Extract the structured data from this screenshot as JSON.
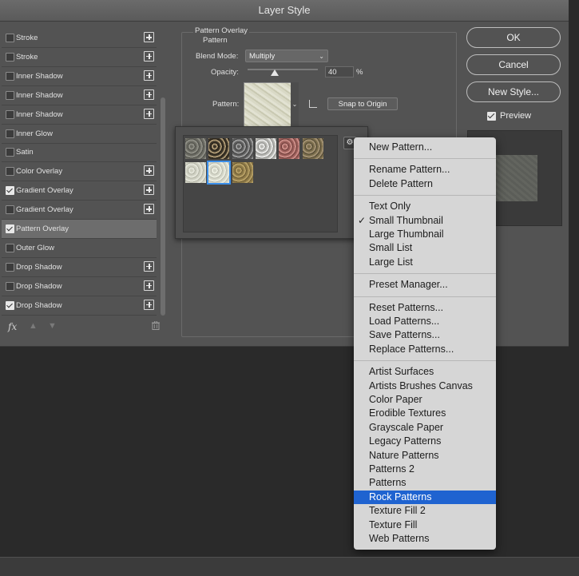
{
  "window": {
    "title": "Layer Style"
  },
  "styles_list": {
    "items": [
      {
        "label": "Stroke",
        "checked": false,
        "has_plus": true
      },
      {
        "label": "Stroke",
        "checked": false,
        "has_plus": true
      },
      {
        "label": "Inner Shadow",
        "checked": false,
        "has_plus": true
      },
      {
        "label": "Inner Shadow",
        "checked": false,
        "has_plus": true
      },
      {
        "label": "Inner Shadow",
        "checked": false,
        "has_plus": true
      },
      {
        "label": "Inner Glow",
        "checked": false,
        "has_plus": false
      },
      {
        "label": "Satin",
        "checked": false,
        "has_plus": false
      },
      {
        "label": "Color Overlay",
        "checked": false,
        "has_plus": true
      },
      {
        "label": "Gradient Overlay",
        "checked": true,
        "has_plus": true
      },
      {
        "label": "Gradient Overlay",
        "checked": false,
        "has_plus": true
      },
      {
        "label": "Pattern Overlay",
        "checked": true,
        "has_plus": false,
        "selected": true
      },
      {
        "label": "Outer Glow",
        "checked": false,
        "has_plus": false
      },
      {
        "label": "Drop Shadow",
        "checked": false,
        "has_plus": true
      },
      {
        "label": "Drop Shadow",
        "checked": false,
        "has_plus": true
      },
      {
        "label": "Drop Shadow",
        "checked": true,
        "has_plus": true
      }
    ],
    "fx_label": "fx",
    "icons": {
      "move_up": "arrow-up-icon",
      "move_down": "arrow-down-icon",
      "delete": "trash-icon"
    }
  },
  "pattern_overlay": {
    "group_title": "Pattern Overlay",
    "subgroup_title": "Pattern",
    "blend_mode_label": "Blend Mode:",
    "blend_mode_value": "Multiply",
    "opacity_label": "Opacity:",
    "opacity_value": "40",
    "opacity_unit": "%",
    "opacity_fraction": 0.4,
    "pattern_label": "Pattern:",
    "snap_button": "Snap to Origin"
  },
  "buttons": {
    "ok": "OK",
    "cancel": "Cancel",
    "new_style": "New Style...",
    "preview_label": "Preview",
    "preview_checked": true
  },
  "pattern_picker": {
    "thumbnails": [
      {
        "name": "rock-pattern-1",
        "colors": [
          "#6a6a62",
          "#8d8d84",
          "#4e4e48"
        ]
      },
      {
        "name": "rock-pattern-2",
        "colors": [
          "#3b3428",
          "#a89470",
          "#1e1a14"
        ]
      },
      {
        "name": "rock-pattern-3",
        "colors": [
          "#5e5e5e",
          "#9a9a9a",
          "#3d3d3d"
        ]
      },
      {
        "name": "rock-pattern-4",
        "colors": [
          "#b6b6b2",
          "#e6e6e4",
          "#8b8b88"
        ]
      },
      {
        "name": "rock-pattern-5",
        "colors": [
          "#9c5f5b",
          "#c98b85",
          "#6d3c39"
        ]
      },
      {
        "name": "rock-pattern-6",
        "colors": [
          "#7a6d4c",
          "#a19071",
          "#4d4430"
        ]
      },
      {
        "name": "rock-pattern-7",
        "colors": [
          "#cfd0c2",
          "#e3e4d8",
          "#b3b4a6"
        ]
      },
      {
        "name": "rock-pattern-8",
        "colors": [
          "#d4d6c8",
          "#eaecdf",
          "#babbae"
        ],
        "selected": true
      },
      {
        "name": "rock-pattern-9",
        "colors": [
          "#8e7a48",
          "#b59e64",
          "#6a5932"
        ]
      }
    ],
    "gear_icon": "gear-icon"
  },
  "context_menu": {
    "selected_view": "Small Thumbnail",
    "highlighted": "Rock Patterns",
    "groups": [
      [
        "New Pattern..."
      ],
      [
        "Rename Pattern...",
        "Delete Pattern"
      ],
      [
        "Text Only",
        "Small Thumbnail",
        "Large Thumbnail",
        "Small List",
        "Large List"
      ],
      [
        "Preset Manager..."
      ],
      [
        "Reset Patterns...",
        "Load Patterns...",
        "Save Patterns...",
        "Replace Patterns..."
      ],
      [
        "Artist Surfaces",
        "Artists Brushes Canvas",
        "Color Paper",
        "Erodible Textures",
        "Grayscale Paper",
        "Legacy Patterns",
        "Nature Patterns",
        "Patterns 2",
        "Patterns",
        "Rock Patterns",
        "Texture Fill 2",
        "Texture Fill",
        "Web Patterns"
      ]
    ]
  }
}
